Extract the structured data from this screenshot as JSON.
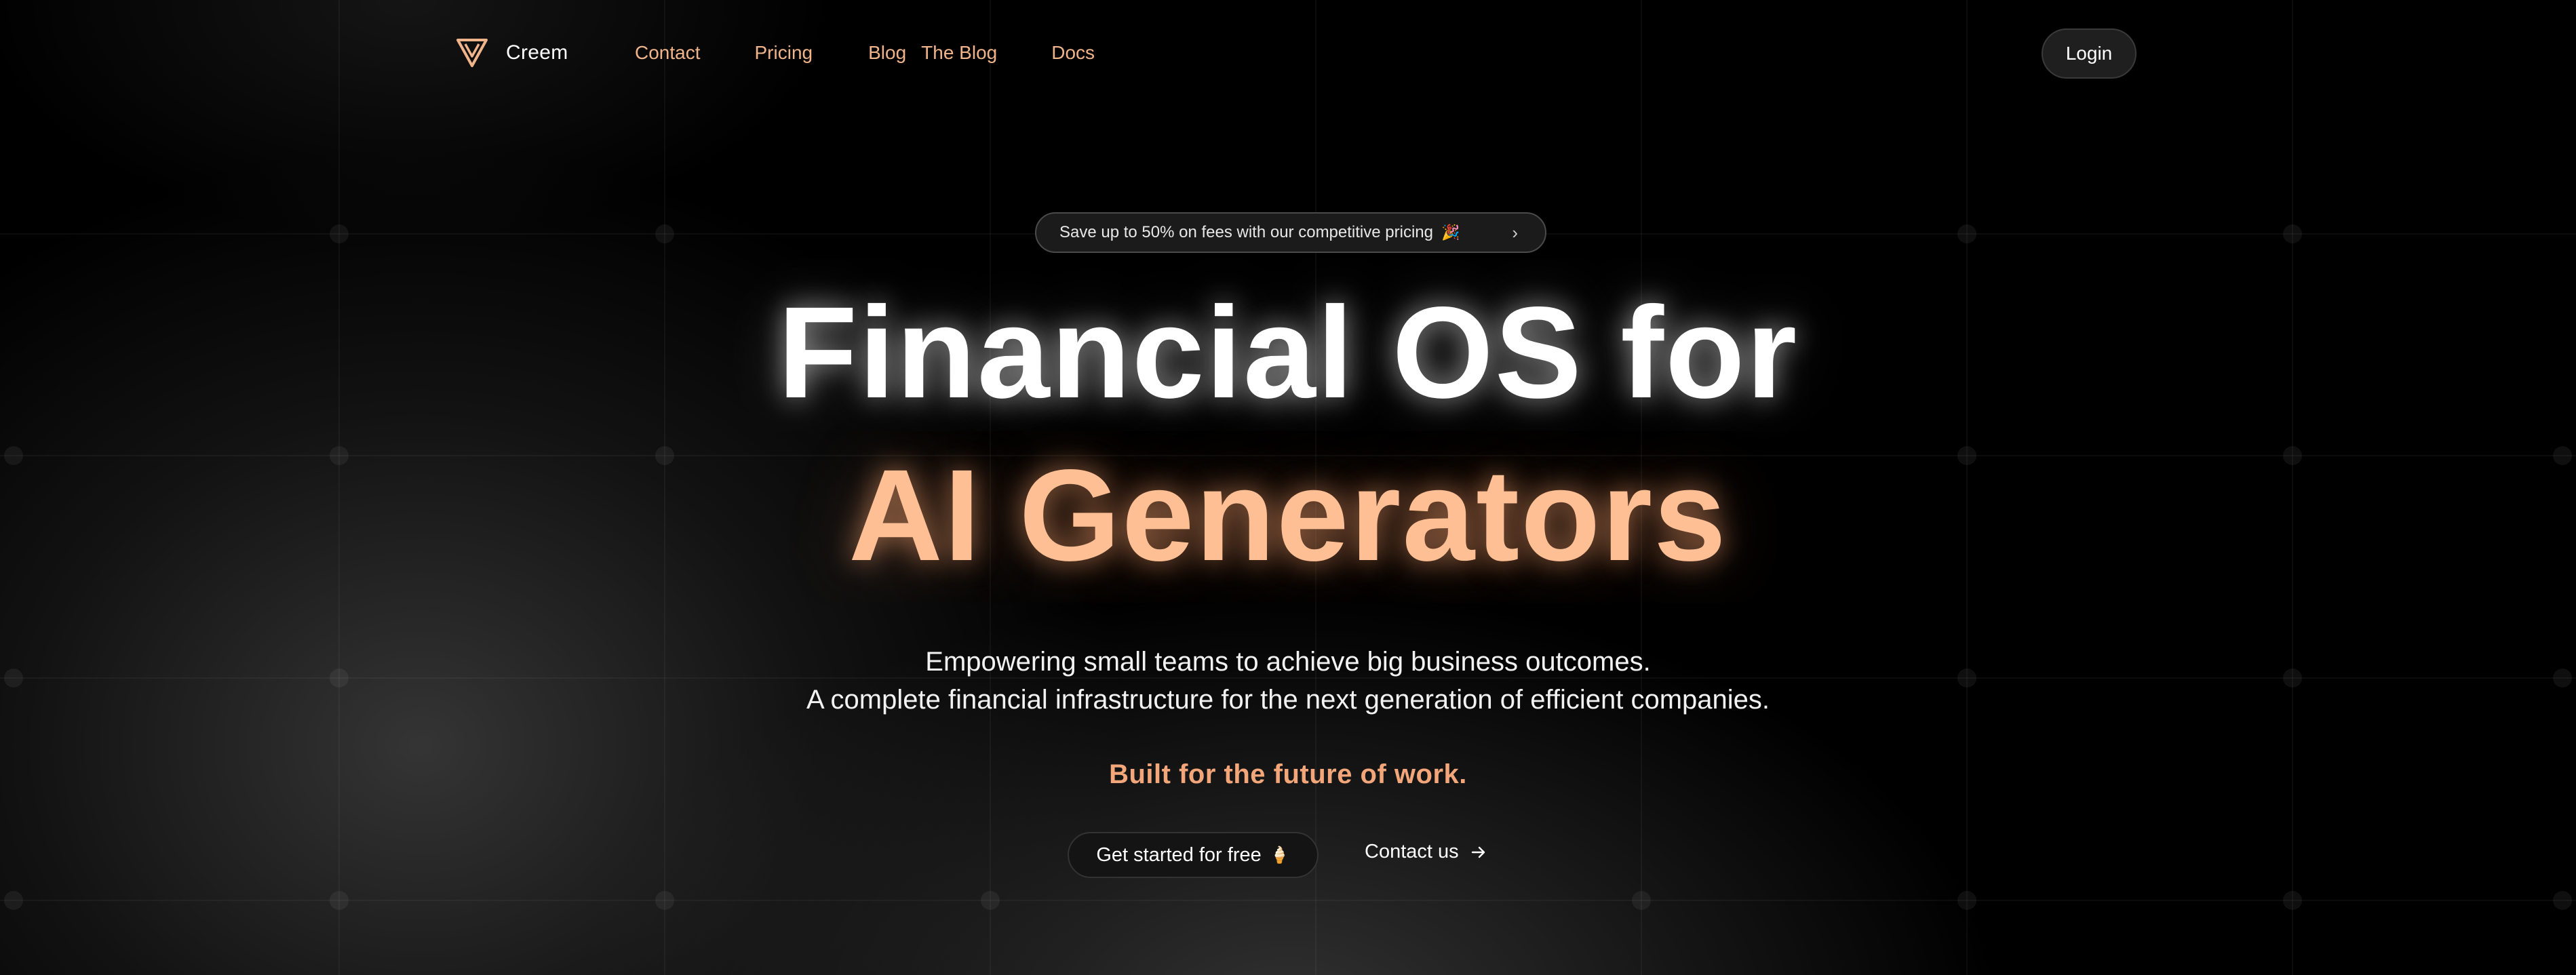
{
  "brand": {
    "name": "Creem",
    "accent": "#f0b48a",
    "logo_icon": "triangle-v-logo-icon"
  },
  "nav": {
    "links": [
      {
        "label": "Contact"
      },
      {
        "label": "Pricing"
      },
      {
        "label": "Blog"
      },
      {
        "label": "The Blog"
      },
      {
        "label": "Docs"
      }
    ],
    "login_label": "Login"
  },
  "promo": {
    "text": "Save up to 50% on fees with our competitive pricing",
    "emoji": "🎉",
    "chevron": "›"
  },
  "hero": {
    "headline_line1": "Financial OS for",
    "headline_line2": "AI Generators",
    "headline_line2_color": "#ffbf94",
    "subtext_line1": "Empowering small teams to achieve big business outcomes.",
    "subtext_line2": "A complete financial infrastructure for the next generation of efficient companies.",
    "tagline": "Built for the future of work."
  },
  "cta": {
    "primary_label": "Get started for free",
    "primary_emoji": "🍦",
    "secondary_label": "Contact us",
    "secondary_icon": "arrow-right-icon"
  }
}
